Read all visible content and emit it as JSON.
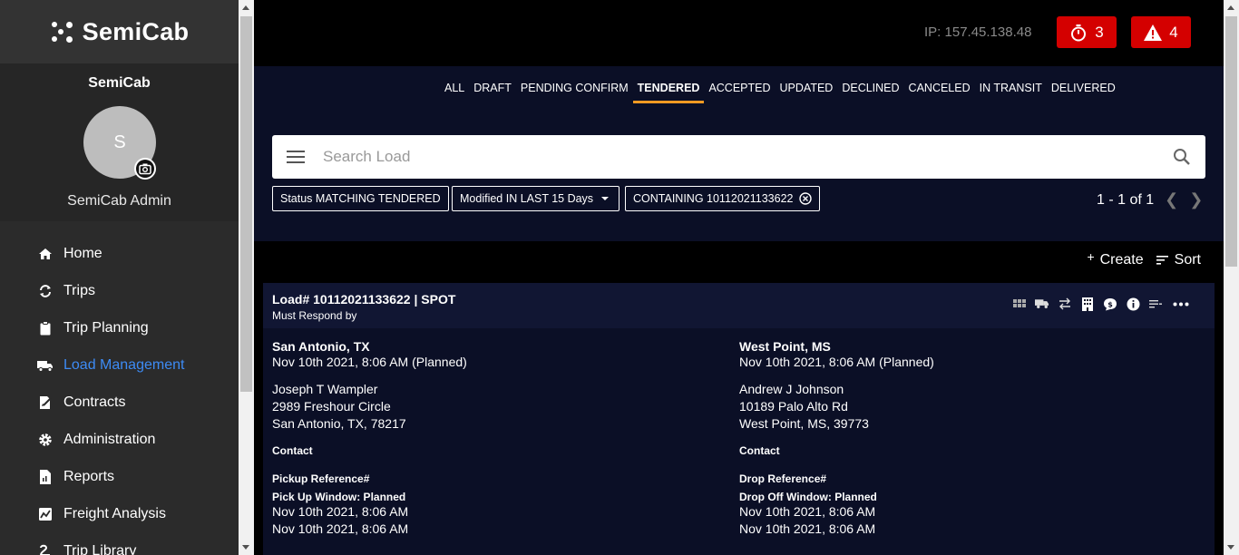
{
  "brand": {
    "name": "SemiCab"
  },
  "profile": {
    "org": "SemiCab",
    "initial": "S",
    "name": "SemiCab Admin"
  },
  "nav": [
    {
      "label": "Home",
      "icon": "home-icon"
    },
    {
      "label": "Trips",
      "icon": "sync-icon"
    },
    {
      "label": "Trip Planning",
      "icon": "clipboard-icon"
    },
    {
      "label": "Load Management",
      "icon": "truck-icon",
      "active": true
    },
    {
      "label": "Contracts",
      "icon": "contract-icon"
    },
    {
      "label": "Administration",
      "icon": "gear-icon"
    },
    {
      "label": "Reports",
      "icon": "report-icon"
    },
    {
      "label": "Freight Analysis",
      "icon": "chart-icon"
    },
    {
      "label": "Trip Library",
      "icon": "library-icon"
    }
  ],
  "topbar": {
    "ip": "IP: 157.45.138.48",
    "timer_count": "3",
    "alert_count": "4"
  },
  "tabs": [
    "ALL",
    "DRAFT",
    "PENDING CONFIRM",
    "TENDERED",
    "ACCEPTED",
    "UPDATED",
    "DECLINED",
    "CANCELED",
    "IN TRANSIT",
    "DELIVERED"
  ],
  "active_tab": "TENDERED",
  "search": {
    "placeholder": "Search Load"
  },
  "chips": {
    "status": "Status MATCHING TENDERED",
    "modified": "Modified IN LAST 15 Days",
    "containing": "CONTAINING 10112021133622"
  },
  "pager": {
    "text": "1 - 1 of 1"
  },
  "actions": {
    "create": "Create",
    "sort": "Sort"
  },
  "load": {
    "title": "Load# 10112021133622 | SPOT",
    "subtitle": "Must Respond by",
    "pickup": {
      "city": "San Antonio, TX",
      "date": "Nov 10th 2021, 8:06 AM (Planned)",
      "name": "Joseph T Wampler",
      "street": "2989 Freshour Circle",
      "citystate": "San Antonio, TX, 78217",
      "contact": "Contact",
      "ref": "Pickup Reference#",
      "window_label": "Pick Up Window: Planned",
      "window_start": "Nov 10th 2021, 8:06 AM",
      "window_end": "Nov 10th 2021, 8:06 AM"
    },
    "drop": {
      "city": "West Point, MS",
      "date": "Nov 10th 2021, 8:06 AM (Planned)",
      "name": "Andrew J Johnson",
      "street": "10189 Palo Alto Rd",
      "citystate": "West Point, MS, 39773",
      "contact": "Contact",
      "ref": "Drop Reference#",
      "window_label": "Drop Off Window: Planned",
      "window_start": "Nov 10th 2021, 8:06 AM",
      "window_end": "Nov 10th 2021, 8:06 AM"
    }
  },
  "colors": {
    "accent_orange": "#f29a22",
    "alert_red": "#d40000",
    "link_blue": "#3d8bf5",
    "panel_navy": "#0b0f26"
  }
}
